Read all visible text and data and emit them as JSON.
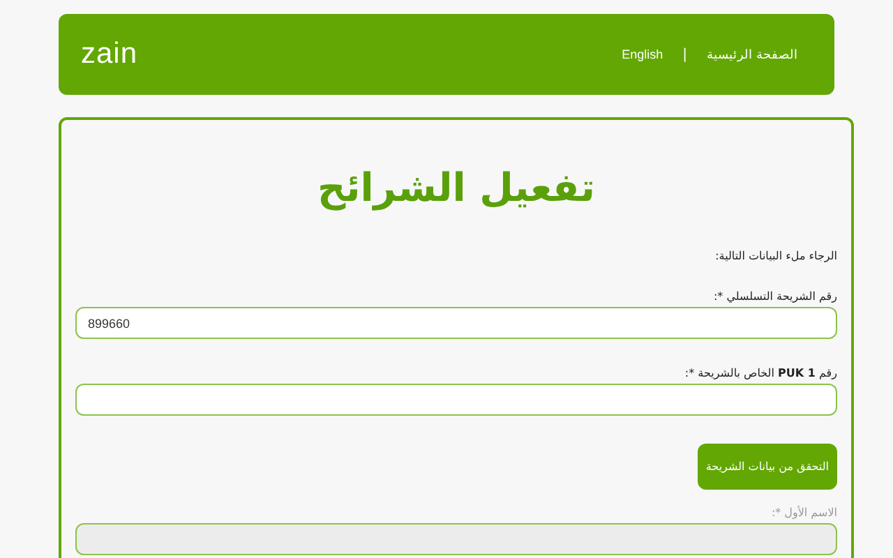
{
  "header": {
    "logo": "zain",
    "nav": [
      {
        "label": "الصفحة الرئيسية"
      },
      {
        "label": "English"
      }
    ],
    "separator": "|"
  },
  "form": {
    "title": "تفعيل الشرائح",
    "intro": "الرجاء ملء البيانات التالية:",
    "fields": [
      {
        "label": "رقم الشريحة التسلسلي *:",
        "value": "899660",
        "disabled": false
      },
      {
        "label": "رقم **PUK 1** الخاص بالشريحة *:",
        "disabled": false
      }
    ],
    "button": "التحقق من بيانات الشريحة",
    "after_fields": [
      {
        "label": "الاسم الأول *:",
        "disabled": true
      }
    ]
  }
}
